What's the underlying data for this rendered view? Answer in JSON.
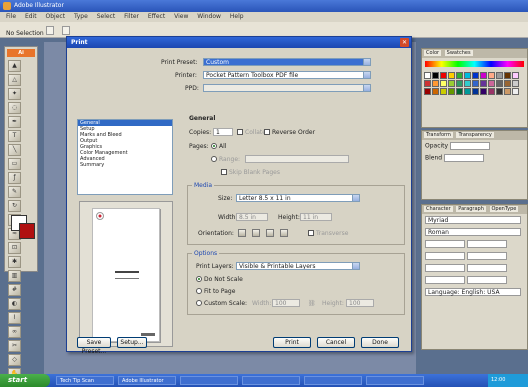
{
  "app": {
    "title": "Adobe Illustrator",
    "menu": [
      "File",
      "Edit",
      "Object",
      "Type",
      "Select",
      "Filter",
      "Effect",
      "View",
      "Window",
      "Help"
    ],
    "options": [
      "No Selection",
      "",
      ""
    ]
  },
  "panels": {
    "color_tabs": [
      "Color",
      "Swatches"
    ],
    "layers_tabs": [
      "Transform",
      "Transparency"
    ],
    "layers_rows": [
      "Opacity",
      "Blend"
    ],
    "char_tabs": [
      "Character",
      "Paragraph",
      "OpenType"
    ],
    "char_font": "Myriad",
    "char_style": "Roman",
    "char_lang": "Language: English: USA"
  },
  "dialog": {
    "title": "Print",
    "print_preset_label": "Print Preset:",
    "print_preset_value": "Custom",
    "printer_label": "Printer:",
    "printer_value": "Pocket Pattern Toolbox PDF file",
    "ppd_label": "PPD:",
    "categories": [
      "General",
      "Setup",
      "Marks and Bleed",
      "Output",
      "Graphics",
      "Color Management",
      "Advanced",
      "Summary"
    ],
    "general_heading": "General",
    "copies_label": "Copies:",
    "copies_value": "1",
    "collate_label": "Collate",
    "reverse_label": "Reverse Order",
    "pages_label": "Pages:",
    "pages_all": "All",
    "range_label": "Range:",
    "skip_blank": "Skip Blank Pages",
    "media_heading": "Media",
    "size_label": "Size:",
    "size_value": "Letter 8.5 x 11 in",
    "width_label": "Width:",
    "width_value": "8.5 in",
    "height_label": "Height:",
    "height_value": "11 in",
    "orientation_label": "Orientation:",
    "transverse_label": "Transverse",
    "options_heading": "Options",
    "print_layers_label": "Print Layers:",
    "print_layers_value": "Visible & Printable Layers",
    "do_not_scale": "Do Not Scale",
    "fit_to_page": "Fit to Page",
    "custom_scale": "Custom Scale:",
    "scale_width_label": "Width:",
    "scale_width_value": "100",
    "scale_height_label": "Height:",
    "scale_height_value": "100",
    "buttons": {
      "save_preset": "Save Preset...",
      "setup": "Setup...",
      "print": "Print",
      "cancel": "Cancel",
      "done": "Done"
    }
  },
  "taskbar": {
    "start": "start",
    "tasks": [
      "Tech Tip Scan",
      "Adobe Illustrator",
      "",
      "",
      "",
      ""
    ],
    "clock": "12:00"
  },
  "colors": {
    "accent": "#2f66d8",
    "selection": "#316ac5"
  }
}
